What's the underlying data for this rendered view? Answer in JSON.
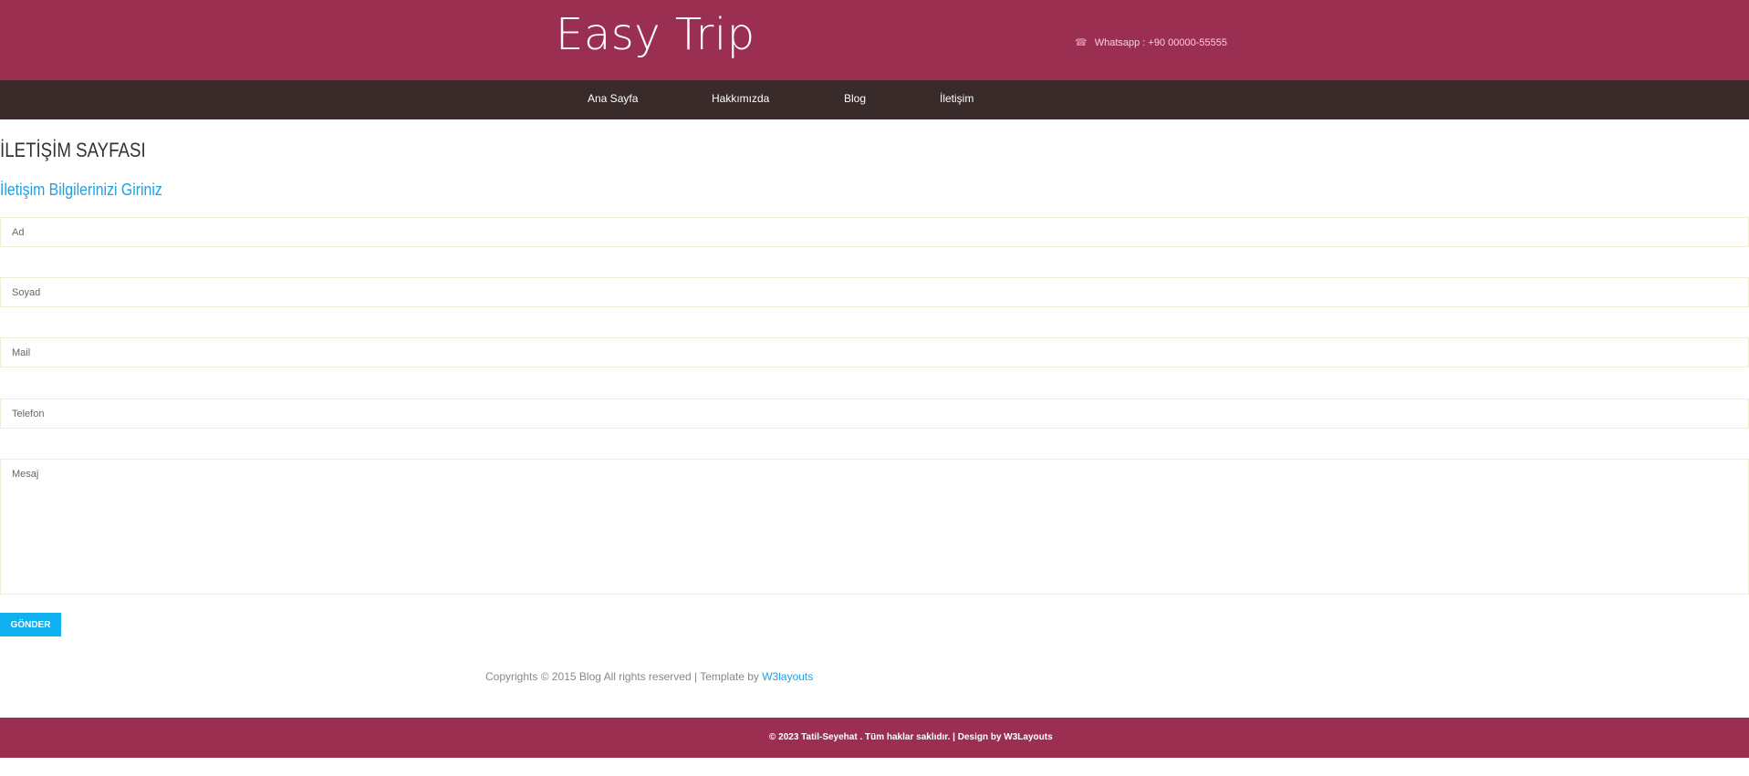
{
  "header": {
    "logo": "Easy Trip",
    "contact_text": "Whatsapp : +90 00000-55555",
    "contact_icon": "phone-icon"
  },
  "nav": {
    "items": [
      {
        "label": "Ana Sayfa"
      },
      {
        "label": "Hakkımızda"
      },
      {
        "label": "Blog"
      },
      {
        "label": "İletişim"
      }
    ]
  },
  "main": {
    "title": "İLETİŞİM SAYFASI",
    "subtitle": "İletişim Bilgilerinizi Giriniz",
    "form": {
      "name_placeholder": "Ad",
      "surname_placeholder": "Soyad",
      "mail_placeholder": "Mail",
      "phone_placeholder": "Telefon",
      "message_placeholder": "Mesaj",
      "submit_label": "GÖNDER"
    },
    "copyright_text": "Copyrights © 2015 Blog All rights reserved | Template by",
    "copyright_link": "W3layouts"
  },
  "footer": {
    "text": "© 2023 Tatil-Seyehat . Tüm haklar saklıdır. | Design by W3Layouts"
  },
  "colors": {
    "header_bg": "#9b2f52",
    "nav_bg": "#3a2b2b",
    "accent": "#1da1e2",
    "button_bg": "#0fb1f0"
  }
}
